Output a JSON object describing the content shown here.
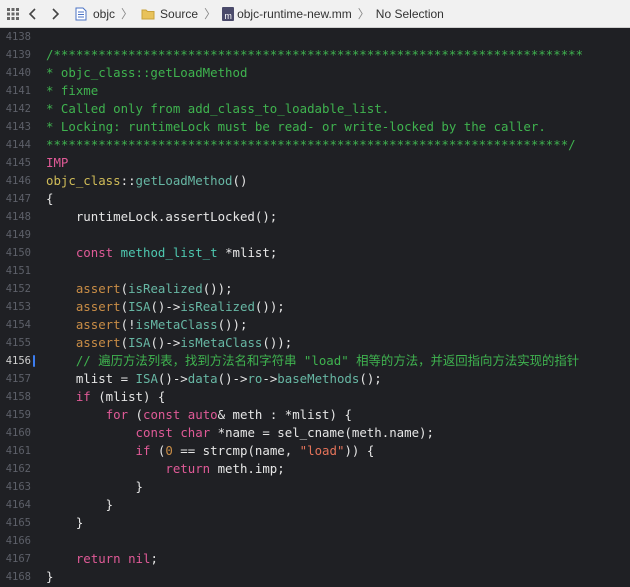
{
  "toolbar": {
    "crumbs": [
      "objc",
      "Source",
      "objc-runtime-new.mm",
      "No Selection"
    ],
    "file_badge": "m"
  },
  "lines": [
    {
      "n": "4138",
      "active": false,
      "parts": []
    },
    {
      "n": "4139",
      "active": false,
      "parts": [
        [
          "cm",
          "/***********************************************************************"
        ]
      ]
    },
    {
      "n": "4140",
      "active": false,
      "parts": [
        [
          "cm",
          "* objc_class::getLoadMethod"
        ]
      ]
    },
    {
      "n": "4141",
      "active": false,
      "parts": [
        [
          "cm",
          "* fixme"
        ]
      ]
    },
    {
      "n": "4142",
      "active": false,
      "parts": [
        [
          "cm",
          "* Called only from add_class_to_loadable_list."
        ]
      ]
    },
    {
      "n": "4143",
      "active": false,
      "parts": [
        [
          "cm",
          "* Locking: runtimeLock must be read- or write-locked by the caller."
        ]
      ]
    },
    {
      "n": "4144",
      "active": false,
      "parts": [
        [
          "cm",
          "**********************************************************************/"
        ]
      ]
    },
    {
      "n": "4145",
      "active": false,
      "parts": [
        [
          "kw",
          "IMP"
        ]
      ]
    },
    {
      "n": "4146",
      "active": false,
      "parts": [
        [
          "ty",
          "objc_class"
        ],
        [
          "pl",
          "::"
        ],
        [
          "fn",
          "getLoadMethod"
        ],
        [
          "pl",
          "()"
        ]
      ]
    },
    {
      "n": "4147",
      "active": false,
      "parts": [
        [
          "pl",
          "{"
        ]
      ]
    },
    {
      "n": "4148",
      "active": false,
      "parts": [
        [
          "pl",
          "    runtimeLock.assertLocked();"
        ]
      ]
    },
    {
      "n": "4149",
      "active": false,
      "parts": []
    },
    {
      "n": "4150",
      "active": false,
      "parts": [
        [
          "pl",
          "    "
        ],
        [
          "kw",
          "const"
        ],
        [
          "pl",
          " "
        ],
        [
          "ct",
          "method_list_t"
        ],
        [
          "pl",
          " *mlist;"
        ]
      ]
    },
    {
      "n": "4151",
      "active": false,
      "parts": []
    },
    {
      "n": "4152",
      "active": false,
      "parts": [
        [
          "pl",
          "    "
        ],
        [
          "nm",
          "assert"
        ],
        [
          "pl",
          "("
        ],
        [
          "fn",
          "isRealized"
        ],
        [
          "pl",
          "());"
        ]
      ]
    },
    {
      "n": "4153",
      "active": false,
      "parts": [
        [
          "pl",
          "    "
        ],
        [
          "nm",
          "assert"
        ],
        [
          "pl",
          "("
        ],
        [
          "fn",
          "ISA"
        ],
        [
          "pl",
          "()->"
        ],
        [
          "fn",
          "isRealized"
        ],
        [
          "pl",
          "());"
        ]
      ]
    },
    {
      "n": "4154",
      "active": false,
      "parts": [
        [
          "pl",
          "    "
        ],
        [
          "nm",
          "assert"
        ],
        [
          "pl",
          "(!"
        ],
        [
          "fn",
          "isMetaClass"
        ],
        [
          "pl",
          "());"
        ]
      ]
    },
    {
      "n": "4155",
      "active": false,
      "parts": [
        [
          "pl",
          "    "
        ],
        [
          "nm",
          "assert"
        ],
        [
          "pl",
          "("
        ],
        [
          "fn",
          "ISA"
        ],
        [
          "pl",
          "()->"
        ],
        [
          "fn",
          "isMetaClass"
        ],
        [
          "pl",
          "());"
        ]
      ]
    },
    {
      "n": "4156",
      "active": true,
      "parts": [
        [
          "pl",
          "    "
        ],
        [
          "cm",
          "// 遍历方法列表，找到方法名和字符串 \"load\" 相等的方法，并返回指向方法实现的指针"
        ]
      ]
    },
    {
      "n": "4157",
      "active": false,
      "parts": [
        [
          "pl",
          "    mlist = "
        ],
        [
          "fn",
          "ISA"
        ],
        [
          "pl",
          "()->"
        ],
        [
          "fn",
          "data"
        ],
        [
          "pl",
          "()->"
        ],
        [
          "fn",
          "ro"
        ],
        [
          "pl",
          "->"
        ],
        [
          "fn",
          "baseMethods"
        ],
        [
          "pl",
          "();"
        ]
      ]
    },
    {
      "n": "4158",
      "active": false,
      "parts": [
        [
          "pl",
          "    "
        ],
        [
          "kw",
          "if"
        ],
        [
          "pl",
          " (mlist) {"
        ]
      ]
    },
    {
      "n": "4159",
      "active": false,
      "parts": [
        [
          "pl",
          "        "
        ],
        [
          "kw",
          "for"
        ],
        [
          "pl",
          " ("
        ],
        [
          "kw",
          "const"
        ],
        [
          "pl",
          " "
        ],
        [
          "kw",
          "auto"
        ],
        [
          "pl",
          "& meth : *mlist) {"
        ]
      ]
    },
    {
      "n": "4160",
      "active": false,
      "parts": [
        [
          "pl",
          "            "
        ],
        [
          "kw",
          "const"
        ],
        [
          "pl",
          " "
        ],
        [
          "kw",
          "char"
        ],
        [
          "pl",
          " *name = sel_cname(meth.name);"
        ]
      ]
    },
    {
      "n": "4161",
      "active": false,
      "parts": [
        [
          "pl",
          "            "
        ],
        [
          "kw",
          "if"
        ],
        [
          "pl",
          " ("
        ],
        [
          "nm",
          "0"
        ],
        [
          "pl",
          " == strcmp(name, "
        ],
        [
          "st",
          "\"load\""
        ],
        [
          "pl",
          ")) {"
        ]
      ]
    },
    {
      "n": "4162",
      "active": false,
      "parts": [
        [
          "pl",
          "                "
        ],
        [
          "kw",
          "return"
        ],
        [
          "pl",
          " meth.imp;"
        ]
      ]
    },
    {
      "n": "4163",
      "active": false,
      "parts": [
        [
          "pl",
          "            }"
        ]
      ]
    },
    {
      "n": "4164",
      "active": false,
      "parts": [
        [
          "pl",
          "        }"
        ]
      ]
    },
    {
      "n": "4165",
      "active": false,
      "parts": [
        [
          "pl",
          "    }"
        ]
      ]
    },
    {
      "n": "4166",
      "active": false,
      "parts": []
    },
    {
      "n": "4167",
      "active": false,
      "parts": [
        [
          "pl",
          "    "
        ],
        [
          "kw",
          "return"
        ],
        [
          "pl",
          " "
        ],
        [
          "kw",
          "nil"
        ],
        [
          "pl",
          ";"
        ]
      ]
    },
    {
      "n": "4168",
      "active": false,
      "parts": [
        [
          "pl",
          "}"
        ]
      ]
    }
  ]
}
